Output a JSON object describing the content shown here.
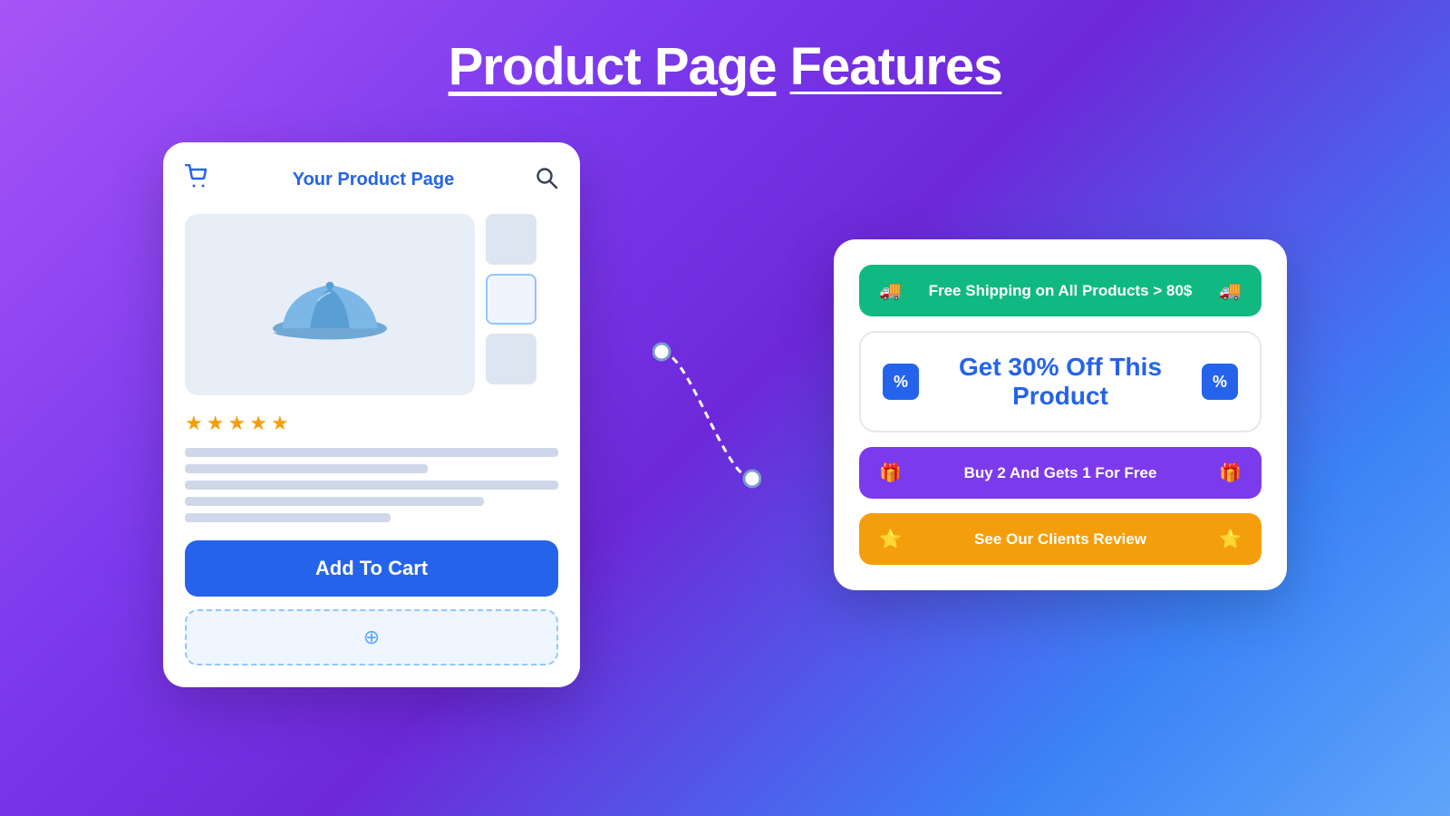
{
  "page": {
    "title": "Product Page",
    "title_underline": "Features"
  },
  "product_mock": {
    "header_title": "Your Product Page",
    "add_to_cart_label": "Add To Cart",
    "add_widget_icon": "⊕"
  },
  "features": {
    "shipping": {
      "label": "Free Shipping on All Products > 80$",
      "icon_left": "🚚",
      "icon_right": "🚚"
    },
    "discount": {
      "label": "Get 30% Off  This Product"
    },
    "bogo": {
      "label": "Buy 2 And Gets 1 For Free",
      "icon_left": "🎁",
      "icon_right": "🎁"
    },
    "review": {
      "label": "See Our Clients Review",
      "icon_left": "⭐",
      "icon_right": "⭐"
    }
  }
}
